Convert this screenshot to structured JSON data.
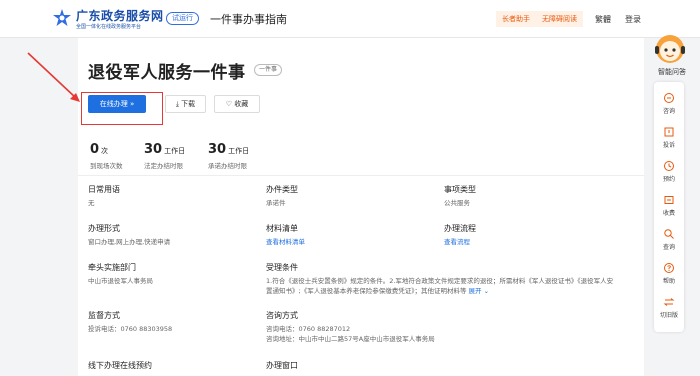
{
  "header": {
    "site_name": "广东政务服务网",
    "site_subtitle": "全国一体化在线政务服务平台",
    "beta_badge": "试运行",
    "page_heading": "一件事办事指南",
    "elder_mode": "长者助手",
    "accessibility": "无障碍阅读",
    "language": "繁體",
    "login": "登录"
  },
  "main": {
    "title": "退役军人服务一件事",
    "tag": "一件事",
    "buttons": {
      "apply": "在线办理 »",
      "download": "下载",
      "favorite": "收藏"
    },
    "stats": [
      {
        "value": "0",
        "unit": "次",
        "label": "到现场次数"
      },
      {
        "value": "30",
        "unit": "工作日",
        "label": "法定办结时限"
      },
      {
        "value": "30",
        "unit": "工作日",
        "label": "承诺办结时限"
      }
    ],
    "fields": {
      "aliases_label": "日常用语",
      "aliases_value": "无",
      "type_label": "办件类型",
      "type_value": "承诺件",
      "category_label": "事项类型",
      "category_value": "公共服务",
      "mode_label": "办理形式",
      "mode_value": "窗口办理,网上办理,快递申请",
      "materials_label": "材料清单",
      "materials_value": "查看材料清单",
      "process_label": "办理流程",
      "process_value": "查看流程",
      "dept_label": "牵头实施部门",
      "dept_value": "中山市退役军人事务局",
      "conditions_label": "受理条件",
      "conditions_value": "1.符合《退役士兵安置条例》规定的条件。2.军地符合政策文件规定要求的退役；所需材料《军人退役证书》《退役军人安置通知书》;《军人退役基本养老保险参保缴费凭证》；其他证明材料等",
      "conditions_more": "展开 ⌄",
      "supervise_label": "监督方式",
      "supervise_value": "投诉电话：0760 88303958",
      "consult_label": "咨询方式",
      "consult_phone": "咨询电话：0760 88287012",
      "consult_addr": "咨询地址：中山市中山二路57号A座中山市退役军人事务局",
      "offline_label": "线下办理在线预约",
      "window_label": "办理窗口"
    }
  },
  "sidebar": {
    "assistant_label": "智能问答",
    "items": [
      {
        "label": "咨询",
        "icon": "chat-icon"
      },
      {
        "label": "投诉",
        "icon": "complaint-icon"
      },
      {
        "label": "预约",
        "icon": "clock-icon"
      },
      {
        "label": "收费",
        "icon": "fee-icon"
      },
      {
        "label": "查询",
        "icon": "search-icon"
      },
      {
        "label": "帮助",
        "icon": "help-icon"
      },
      {
        "label": "切旧版",
        "icon": "switch-icon"
      }
    ]
  },
  "colors": {
    "brand_blue": "#1a4ea8",
    "primary_button": "#1e6fe0",
    "annotation_red": "#e53935",
    "elder_orange": "#e8590c"
  }
}
